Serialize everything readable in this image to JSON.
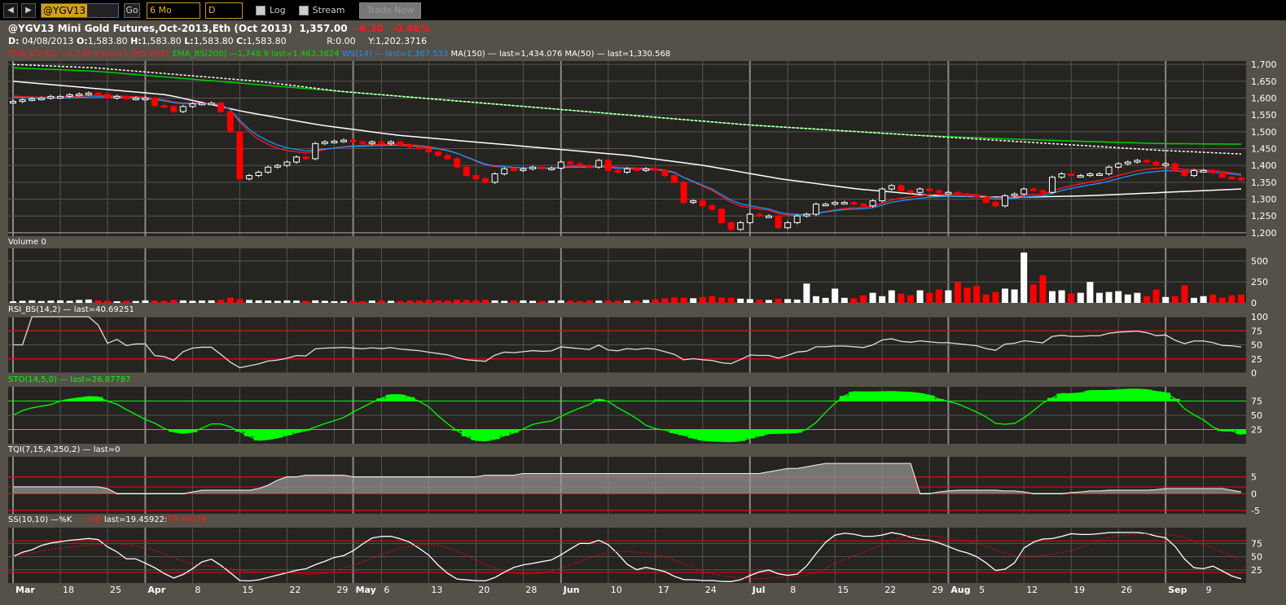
{
  "toolbar": {
    "back": "◀",
    "forward": "▶",
    "symbol": "@YGV13",
    "go": "Go",
    "period": "6 Mo",
    "interval": "D",
    "log": "Log",
    "stream": "Stream",
    "trade": "Trade Now"
  },
  "header": {
    "title": "@YGV13 Mini Gold Futures,Oct-2013,Eth (Oct 2013)",
    "price": "1,357.00",
    "change": "-6.30",
    "pct": "-0.46%",
    "d_label": "D:",
    "date": "04/08/2013",
    "o_label": "O:",
    "o": "1,583.80",
    "h_label": "H:",
    "h": "1,583.80",
    "l_label": "L:",
    "l": "1,583.80",
    "c_label": "C:",
    "c": "1,583.80",
    "r": "R:0.00",
    "y": "Y:1,202.3716"
  },
  "legend": {
    "ema30": "EMA_BS(30) —1,748.9 last=1,365.0942",
    "ema200": "EMA_BS(200) —1,748.9 last=1,463.3824",
    "ws14": "WS(14) — last=1,367.533",
    "ma150": "MA(150) --- last=1,434.076",
    "ma50": "MA(50) — last=1,330.568"
  },
  "panels": {
    "volume": "Volume 0",
    "rsi": "RSI_BS(14,2) — last=40.69251",
    "sto": "STO(14,5,0) — last=26.87787",
    "tqi": "TQI(7,15,4,250,2) — last=0",
    "ss_a": "SS(10,10) —%K ",
    "ss_b": "·····%D ",
    "ss_c": "last=19.45922:",
    "ss_d": "53.89048"
  },
  "colors": {
    "up": "#ffffff",
    "down": "#ff0000",
    "ema30": "#ff1a1a",
    "ema200": "#00d000",
    "ws": "#1e90ff",
    "ma": "#ffffff",
    "sto_fill": "#00ff00",
    "bg": "#262421",
    "frame": "#555048"
  },
  "chart_data": {
    "type": "candlestick",
    "ylim": [
      1190,
      1710
    ],
    "price_ticks": [
      "1,700",
      "1,650",
      "1,600",
      "1,550",
      "1,500",
      "1,450",
      "1,400",
      "1,350",
      "1,300",
      "1,250",
      "1,200"
    ],
    "price_tick_values": [
      1700,
      1650,
      1600,
      1550,
      1500,
      1450,
      1400,
      1350,
      1300,
      1250,
      1200
    ],
    "volume_ticks": [
      "500",
      "250",
      "0"
    ],
    "rsi_ticks": [
      "100",
      "75",
      "50",
      "25",
      "0"
    ],
    "sto_ticks": [
      "75",
      "50",
      "25"
    ],
    "tqi_ticks": [
      "5",
      "0",
      "-5"
    ],
    "ss_ticks": [
      "75",
      "50",
      "25"
    ],
    "x_labels": [
      {
        "t": "Mar",
        "i": 0
      },
      {
        "t": "18",
        "i": 5
      },
      {
        "t": "25",
        "i": 10
      },
      {
        "t": "Apr",
        "i": 14
      },
      {
        "t": "8",
        "i": 19
      },
      {
        "t": "15",
        "i": 24
      },
      {
        "t": "22",
        "i": 29
      },
      {
        "t": "29",
        "i": 34
      },
      {
        "t": "May",
        "i": 36
      },
      {
        "t": "6",
        "i": 39
      },
      {
        "t": "13",
        "i": 44
      },
      {
        "t": "20",
        "i": 49
      },
      {
        "t": "28",
        "i": 54
      },
      {
        "t": "Jun",
        "i": 58
      },
      {
        "t": "10",
        "i": 63
      },
      {
        "t": "17",
        "i": 68
      },
      {
        "t": "24",
        "i": 73
      },
      {
        "t": "Jul",
        "i": 78
      },
      {
        "t": "8",
        "i": 82
      },
      {
        "t": "15",
        "i": 87
      },
      {
        "t": "22",
        "i": 92
      },
      {
        "t": "29",
        "i": 97
      },
      {
        "t": "Aug",
        "i": 99
      },
      {
        "t": "5",
        "i": 102
      },
      {
        "t": "12",
        "i": 107
      },
      {
        "t": "19",
        "i": 112
      },
      {
        "t": "26",
        "i": 117
      },
      {
        "t": "Sep",
        "i": 122
      },
      {
        "t": "9",
        "i": 126
      }
    ],
    "close": [
      1590,
      1595,
      1598,
      1600,
      1605,
      1605,
      1610,
      1612,
      1615,
      1612,
      1600,
      1605,
      1598,
      1600,
      1600,
      1578,
      1575,
      1560,
      1575,
      1583,
      1585,
      1585,
      1560,
      1500,
      1360,
      1370,
      1380,
      1395,
      1400,
      1410,
      1425,
      1420,
      1465,
      1470,
      1472,
      1475,
      1470,
      1465,
      1470,
      1465,
      1470,
      1460,
      1455,
      1450,
      1440,
      1430,
      1420,
      1395,
      1370,
      1360,
      1350,
      1375,
      1390,
      1385,
      1390,
      1395,
      1390,
      1392,
      1410,
      1405,
      1400,
      1395,
      1415,
      1385,
      1380,
      1390,
      1385,
      1390,
      1385,
      1370,
      1350,
      1290,
      1295,
      1280,
      1270,
      1230,
      1210,
      1230,
      1255,
      1250,
      1250,
      1215,
      1230,
      1250,
      1255,
      1285,
      1285,
      1290,
      1290,
      1285,
      1280,
      1295,
      1330,
      1340,
      1325,
      1320,
      1330,
      1325,
      1320,
      1320,
      1315,
      1310,
      1305,
      1290,
      1280,
      1310,
      1315,
      1330,
      1325,
      1320,
      1365,
      1375,
      1370,
      1370,
      1375,
      1375,
      1395,
      1405,
      1410,
      1415,
      1410,
      1400,
      1405,
      1385,
      1370,
      1385,
      1385,
      1378,
      1365,
      1363,
      1357
    ],
    "volume": [
      20,
      25,
      30,
      22,
      28,
      30,
      25,
      35,
      40,
      30,
      25,
      20,
      25,
      22,
      30,
      28,
      25,
      35,
      30,
      25,
      28,
      30,
      40,
      60,
      45,
      35,
      30,
      28,
      25,
      30,
      28,
      25,
      30,
      25,
      20,
      22,
      25,
      20,
      28,
      30,
      25,
      22,
      30,
      28,
      35,
      30,
      28,
      40,
      35,
      30,
      38,
      30,
      25,
      28,
      30,
      25,
      22,
      28,
      30,
      25,
      22,
      30,
      28,
      30,
      25,
      30,
      28,
      35,
      40,
      55,
      65,
      60,
      55,
      70,
      80,
      65,
      60,
      50,
      45,
      40,
      35,
      50,
      45,
      40,
      230,
      80,
      60,
      170,
      60,
      55,
      90,
      120,
      80,
      150,
      110,
      90,
      150,
      120,
      160,
      150,
      250,
      180,
      200,
      100,
      130,
      170,
      160,
      600,
      220,
      330,
      140,
      150,
      110,
      120,
      250,
      120,
      130,
      140,
      100,
      120,
      80,
      160,
      70,
      80,
      210,
      60,
      80,
      100,
      60,
      90,
      100
    ],
    "tqi": [
      2,
      2,
      2,
      2,
      2,
      2,
      2,
      2,
      1.5,
      0,
      0,
      0,
      0,
      0,
      0,
      0.5,
      1,
      1,
      1,
      1,
      1.5,
      2.5,
      4,
      5,
      5.5,
      5.5,
      5.5,
      5.5,
      5,
      5,
      5,
      5,
      5,
      5,
      5,
      5,
      5,
      5,
      5,
      5.5,
      5.5,
      5.5,
      6,
      6,
      6,
      6,
      6,
      6,
      6,
      6,
      6,
      6,
      6,
      6,
      6,
      6,
      6,
      6,
      6,
      6,
      6,
      6,
      6.5,
      7,
      7.5,
      8,
      8.5,
      9,
      9,
      9,
      9,
      9,
      9,
      9,
      9,
      0,
      0.5,
      0.8,
      1,
      1,
      1,
      1,
      0.8,
      0.5,
      0,
      0,
      0,
      0.3,
      0.5,
      0.8,
      1,
      1,
      1,
      1,
      1.2,
      1.5,
      1.5,
      1.5,
      1.5,
      1.5,
      1,
      0.5
    ],
    "ma50_keys": [
      1650,
      1630,
      1610,
      1560,
      1520,
      1490,
      1470,
      1450,
      1430,
      1400,
      1360,
      1330,
      1310,
      1305,
      1310,
      1320,
      1330
    ],
    "ma150_keys": [
      1700,
      1690,
      1670,
      1650,
      1620,
      1600,
      1580,
      1560,
      1540,
      1520,
      1505,
      1490,
      1475,
      1460,
      1445,
      1434
    ],
    "ema200_keys": [
      1690,
      1680,
      1660,
      1640,
      1620,
      1600,
      1580,
      1560,
      1540,
      1520,
      1505,
      1490,
      1480,
      1472,
      1465,
      1463
    ]
  }
}
